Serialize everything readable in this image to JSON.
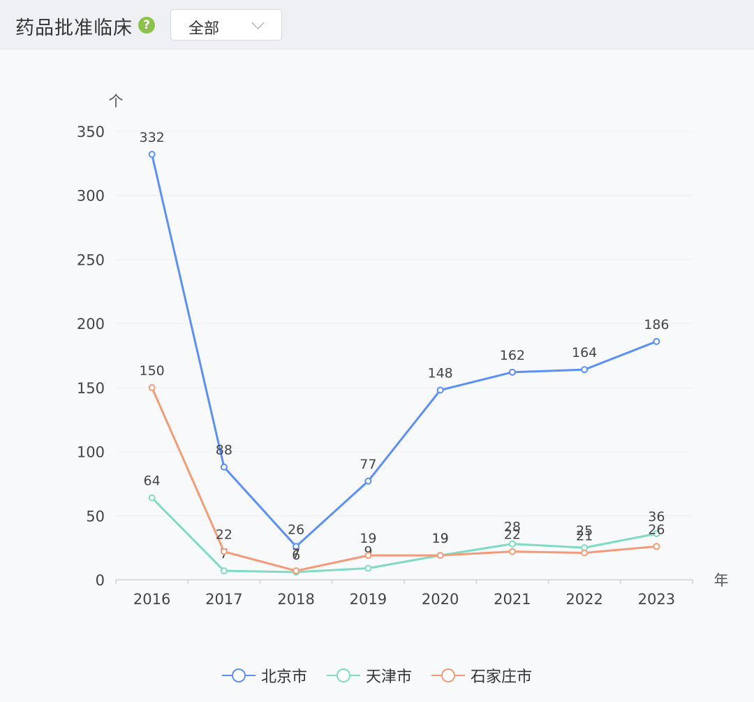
{
  "header": {
    "title": "药品批准临床",
    "help_icon": "question-circle-icon",
    "help_glyph": "?",
    "filter_value": "全部",
    "filter_icon": "chevron-down-icon"
  },
  "colors": {
    "北京市": "#5b8ff9",
    "天津市": "#7ddcc2",
    "石家庄市": "#f59a76",
    "help": "#8bc34a"
  },
  "chart_data": {
    "type": "line",
    "title": "",
    "xlabel": "年",
    "ylabel": "个",
    "ylim": [
      0,
      350
    ],
    "yticks": [
      0,
      50,
      100,
      150,
      200,
      250,
      300,
      350
    ],
    "categories": [
      "2016",
      "2017",
      "2018",
      "2019",
      "2020",
      "2021",
      "2022",
      "2023"
    ],
    "grid": true,
    "legend_position": "bottom",
    "series": [
      {
        "name": "北京市",
        "values": [
          332,
          88,
          26,
          77,
          148,
          162,
          164,
          186
        ]
      },
      {
        "name": "天津市",
        "values": [
          64,
          7,
          6,
          9,
          19,
          28,
          25,
          36
        ]
      },
      {
        "name": "石家庄市",
        "values": [
          150,
          22,
          7,
          19,
          19,
          22,
          21,
          26
        ]
      }
    ]
  }
}
